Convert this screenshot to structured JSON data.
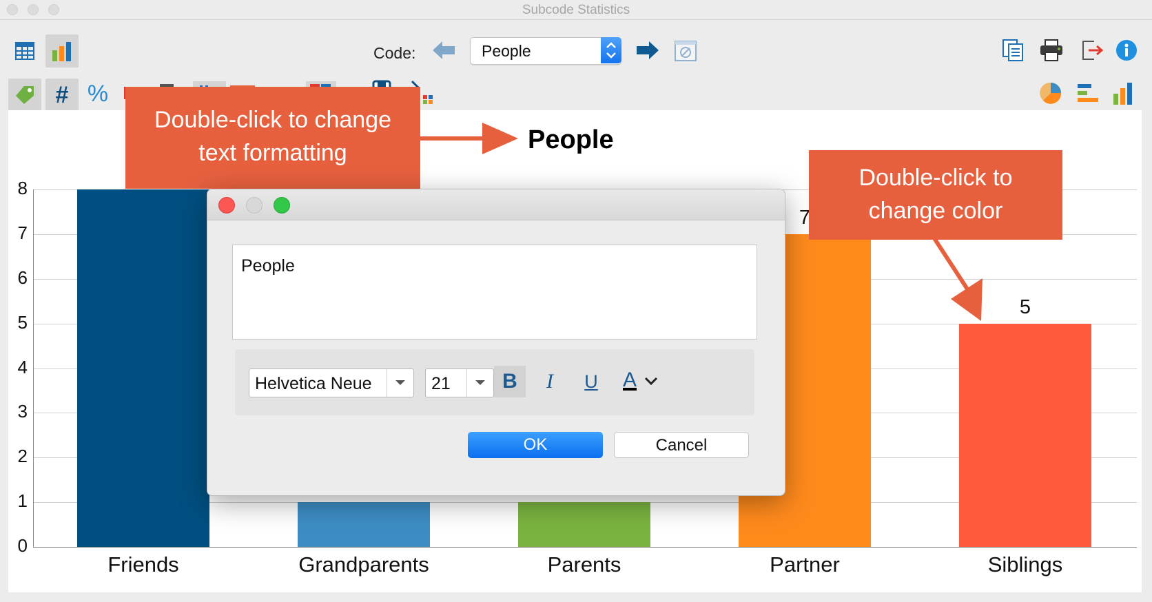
{
  "window": {
    "title": "Subcode Statistics"
  },
  "toolbar": {
    "code_label": "Code:",
    "code_value": "People"
  },
  "chart_data": {
    "type": "bar",
    "title": "People",
    "categories": [
      "Friends",
      "Grandparents",
      "Parents",
      "Partner",
      "Siblings"
    ],
    "values": [
      8,
      1,
      1,
      7,
      5
    ],
    "value_labels": [
      "",
      "",
      "",
      "7",
      "5"
    ],
    "colors": [
      "#004f80",
      "#3d8dc4",
      "#7ab340",
      "#ff8a1c",
      "#ff5a3d"
    ],
    "ylim": [
      0,
      8
    ],
    "yticks": [
      "0",
      "1",
      "2",
      "3",
      "4",
      "5",
      "6",
      "7",
      "8"
    ],
    "grid": true
  },
  "callouts": {
    "text_formatting": [
      "Double-click to change",
      "text formatting"
    ],
    "color": [
      "Double-click to",
      "change color"
    ]
  },
  "dialog": {
    "text_value": "People",
    "font_family": "Helvetica Neue",
    "font_size": "21",
    "bold_label": "B",
    "italic_label": "I",
    "underline_label": "U",
    "color_label": "A",
    "ok_label": "OK",
    "cancel_label": "Cancel"
  }
}
